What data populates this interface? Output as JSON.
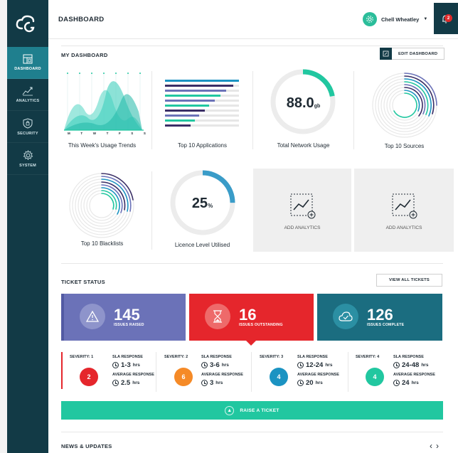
{
  "sidebar": {
    "items": [
      {
        "label": "DASHBOARD",
        "icon": "dashboard-icon"
      },
      {
        "label": "ANALYTICS",
        "icon": "analytics-icon"
      },
      {
        "label": "SECURITY",
        "icon": "shield-icon"
      },
      {
        "label": "SYSTEM",
        "icon": "gear-icon"
      }
    ]
  },
  "header": {
    "title": "DASHBOARD",
    "user_name": "Chell Wheatley",
    "notification_count": "2"
  },
  "my_dashboard": {
    "title": "MY DASHBOARD",
    "edit_label": "EDIT DASHBOARD",
    "tiles": {
      "usage_trends": {
        "label": "This Week's Usage Trends",
        "days": [
          "M",
          "T",
          "W",
          "T",
          "F",
          "S",
          "S"
        ]
      },
      "top_apps": {
        "label": "Top 10 Applications"
      },
      "network_usage": {
        "label": "Total Network Usage",
        "value": "88.0",
        "unit": "gb",
        "fraction": 0.22
      },
      "top_sources": {
        "label": "Top 10 Sources"
      },
      "top_blacklists": {
        "label": "Top 10 Blacklists"
      },
      "licence": {
        "label": "Licence Level Utilised",
        "value": "25",
        "unit": "%",
        "fraction": 0.25
      },
      "add1": {
        "label": "ADD ANALYTICS"
      },
      "add2": {
        "label": "ADD ANALYTICS"
      }
    }
  },
  "tickets": {
    "title": "TICKET STATUS",
    "view_all_label": "VIEW ALL TICKETS",
    "cards": [
      {
        "value": "145",
        "label": "ISSUES RAISED",
        "color": "#6b72b8"
      },
      {
        "value": "16",
        "label": "ISSUES OUTSTANDING",
        "color": "#e5262c"
      },
      {
        "value": "126",
        "label": "ISSUES COMPLETE",
        "color": "#1b6d80"
      }
    ],
    "severities": [
      {
        "label": "SEVERITY: 1",
        "count": "2",
        "color": "#e5262c",
        "sla": "1-3",
        "avg": "2.5"
      },
      {
        "label": "SEVERITY: 2",
        "count": "6",
        "color": "#f58a27",
        "sla": "3-6",
        "avg": "3"
      },
      {
        "label": "SEVERITY: 3",
        "count": "4",
        "color": "#1b93c2",
        "sla": "12-24",
        "avg": "20"
      },
      {
        "label": "SEVERITY: 4",
        "count": "4",
        "color": "#21c7a0",
        "sla": "24-48",
        "avg": "24"
      }
    ],
    "sla_heading": "SLA RESPONSE",
    "avg_heading": "AVERAGE RESPONSE",
    "unit": "hrs",
    "raise_label": "RAISE A TICKET"
  },
  "news": {
    "title": "NEWS & UPDATES"
  },
  "colors": {
    "accent": "#21c7a0",
    "sidebar": "#123a46"
  }
}
